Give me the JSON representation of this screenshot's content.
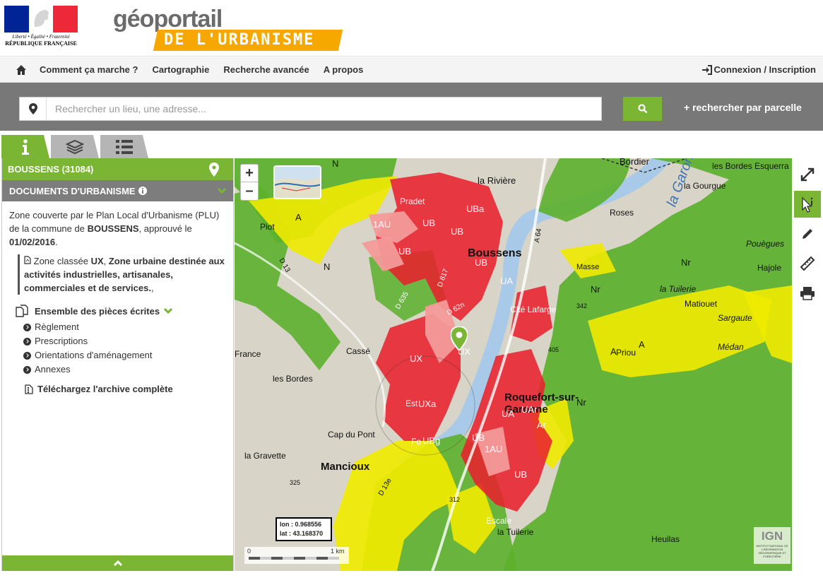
{
  "header": {
    "rf": {
      "motto": "Liberté • Égalité • Fraternité",
      "name": "RÉPUBLIQUE FRANÇAISE"
    },
    "brand": {
      "title": "géoportail",
      "subtitle": "DE L'URBANISME"
    }
  },
  "nav": {
    "items": [
      "Comment ça marche ?",
      "Cartographie",
      "Recherche avancée",
      "A propos"
    ],
    "login": "Connexion / Inscription"
  },
  "search": {
    "placeholder": "Rechercher un lieu, une adresse...",
    "parcelle": "+ rechercher par parcelle"
  },
  "panel": {
    "commune": "BOUSSENS (31084)",
    "docs_title": "DOCUMENTS D'URBANISME",
    "zone_text_1": "Zone couverte par le Plan Local d'Urbanisme (PLU) de la commune de ",
    "zone_commune": "BOUSSENS",
    "zone_text_2": ", approuvé le ",
    "zone_date": "01/02/2016",
    "zone_text_3": ".",
    "classe_prefix": "Zone classée ",
    "classe_code": "UX",
    "classe_sep": ", ",
    "classe_desc": "Zone urbaine destinée aux activités industrielles, artisanales, commerciales et de services.",
    "classe_end": ",",
    "pieces_title": "Ensemble des pièces écrites",
    "pieces": [
      "Règlement",
      "Prescriptions",
      "Orientations d'aménagement",
      "Annexes"
    ],
    "archive": "Téléchargez l'archive complète"
  },
  "map": {
    "zoom_in": "+",
    "zoom_out": "–",
    "coords": {
      "lon_label": "lon :",
      "lon": "0.968556",
      "lat_label": "lat :",
      "lat": "43.168370"
    },
    "scale": {
      "start": "0",
      "end": "1 km"
    },
    "ign": {
      "logo": "IGN",
      "caption": "INSTITUT NATIONAL DE L'INFORMATION GÉOGRAPHIQUE ET FORESTIÈRE"
    },
    "places": [
      "la Rivière",
      "Bordier",
      "les Bordes Esquerra",
      "la Gourgue",
      "la Garonne",
      "Roses",
      "Pouègues",
      "Hajole",
      "la Tuilerie",
      "Matiouet",
      "Sargaute",
      "Médan",
      "Priou",
      "Pradet",
      "Boussens",
      "Cité Lafarge",
      "Cassé",
      "France",
      "les Bordes",
      "Roquefort-sur-Garonne",
      "Cap du Pont",
      "la Gravette",
      "Mancioux",
      "Escale",
      "la Tuilerie",
      "Heuilas",
      "Piot",
      "Est",
      "Fo",
      "Cim",
      "Gare",
      "Masse"
    ],
    "roads": [
      "D 13",
      "D 635",
      "D 817",
      "D 62n",
      "A 64",
      "D 62",
      "D 13e"
    ],
    "elevations": [
      "342",
      "405",
      "325",
      "312",
      "363",
      "350",
      "363"
    ],
    "zones": [
      "N",
      "A",
      "UBa",
      "UB",
      "1AU",
      "UB",
      "UB",
      "UB",
      "UA",
      "UX",
      "UX",
      "UXa",
      "UBg",
      "UB",
      "1AU",
      "UA",
      "UAr",
      "Ar",
      "UB",
      "Nr",
      "Nr",
      "A",
      "A",
      "N",
      "Nr"
    ]
  },
  "toolbar": [
    "fullscreen-icon",
    "info-cursor-icon",
    "pencil-icon",
    "ruler-icon",
    "print-icon"
  ]
}
